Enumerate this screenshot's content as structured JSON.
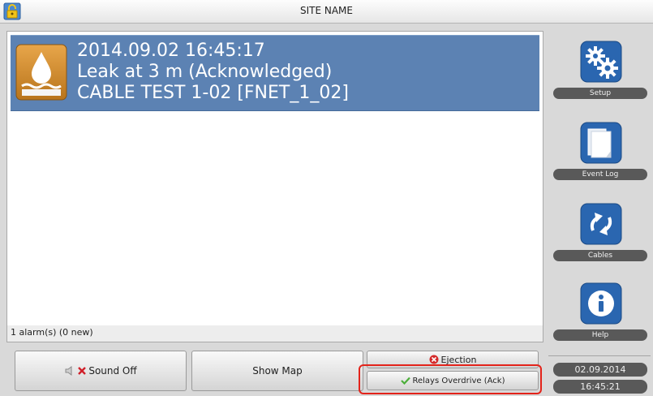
{
  "header": {
    "site_name": "SITE NAME",
    "lock_icon": "lock-icon"
  },
  "alarm_list": {
    "items": [
      {
        "timestamp": "2014.09.02 16:45:17",
        "message": "Leak at 3 m  (Acknowledged)",
        "cable": "CABLE TEST 1-02 [FNET_1_02]",
        "icon": "water-leak-icon",
        "selected": true
      }
    ],
    "status": "1 alarm(s) (0 new)"
  },
  "buttons": {
    "sound_off": "Sound Off",
    "show_map": "Show Map",
    "ejection": "Ejection",
    "relays_overdrive": "Relays Overdrive (Ack)"
  },
  "sidebar": {
    "setup": "Setup",
    "event_log": "Event Log",
    "cables": "Cables",
    "help": "Help"
  },
  "clock": {
    "date": "02.09.2014",
    "time": "16:45:21"
  },
  "colors": {
    "selected_row": "#5c82b3",
    "sidebar_icon": "#2a66b0",
    "highlight": "#e3241b",
    "label_pill": "#595959"
  }
}
